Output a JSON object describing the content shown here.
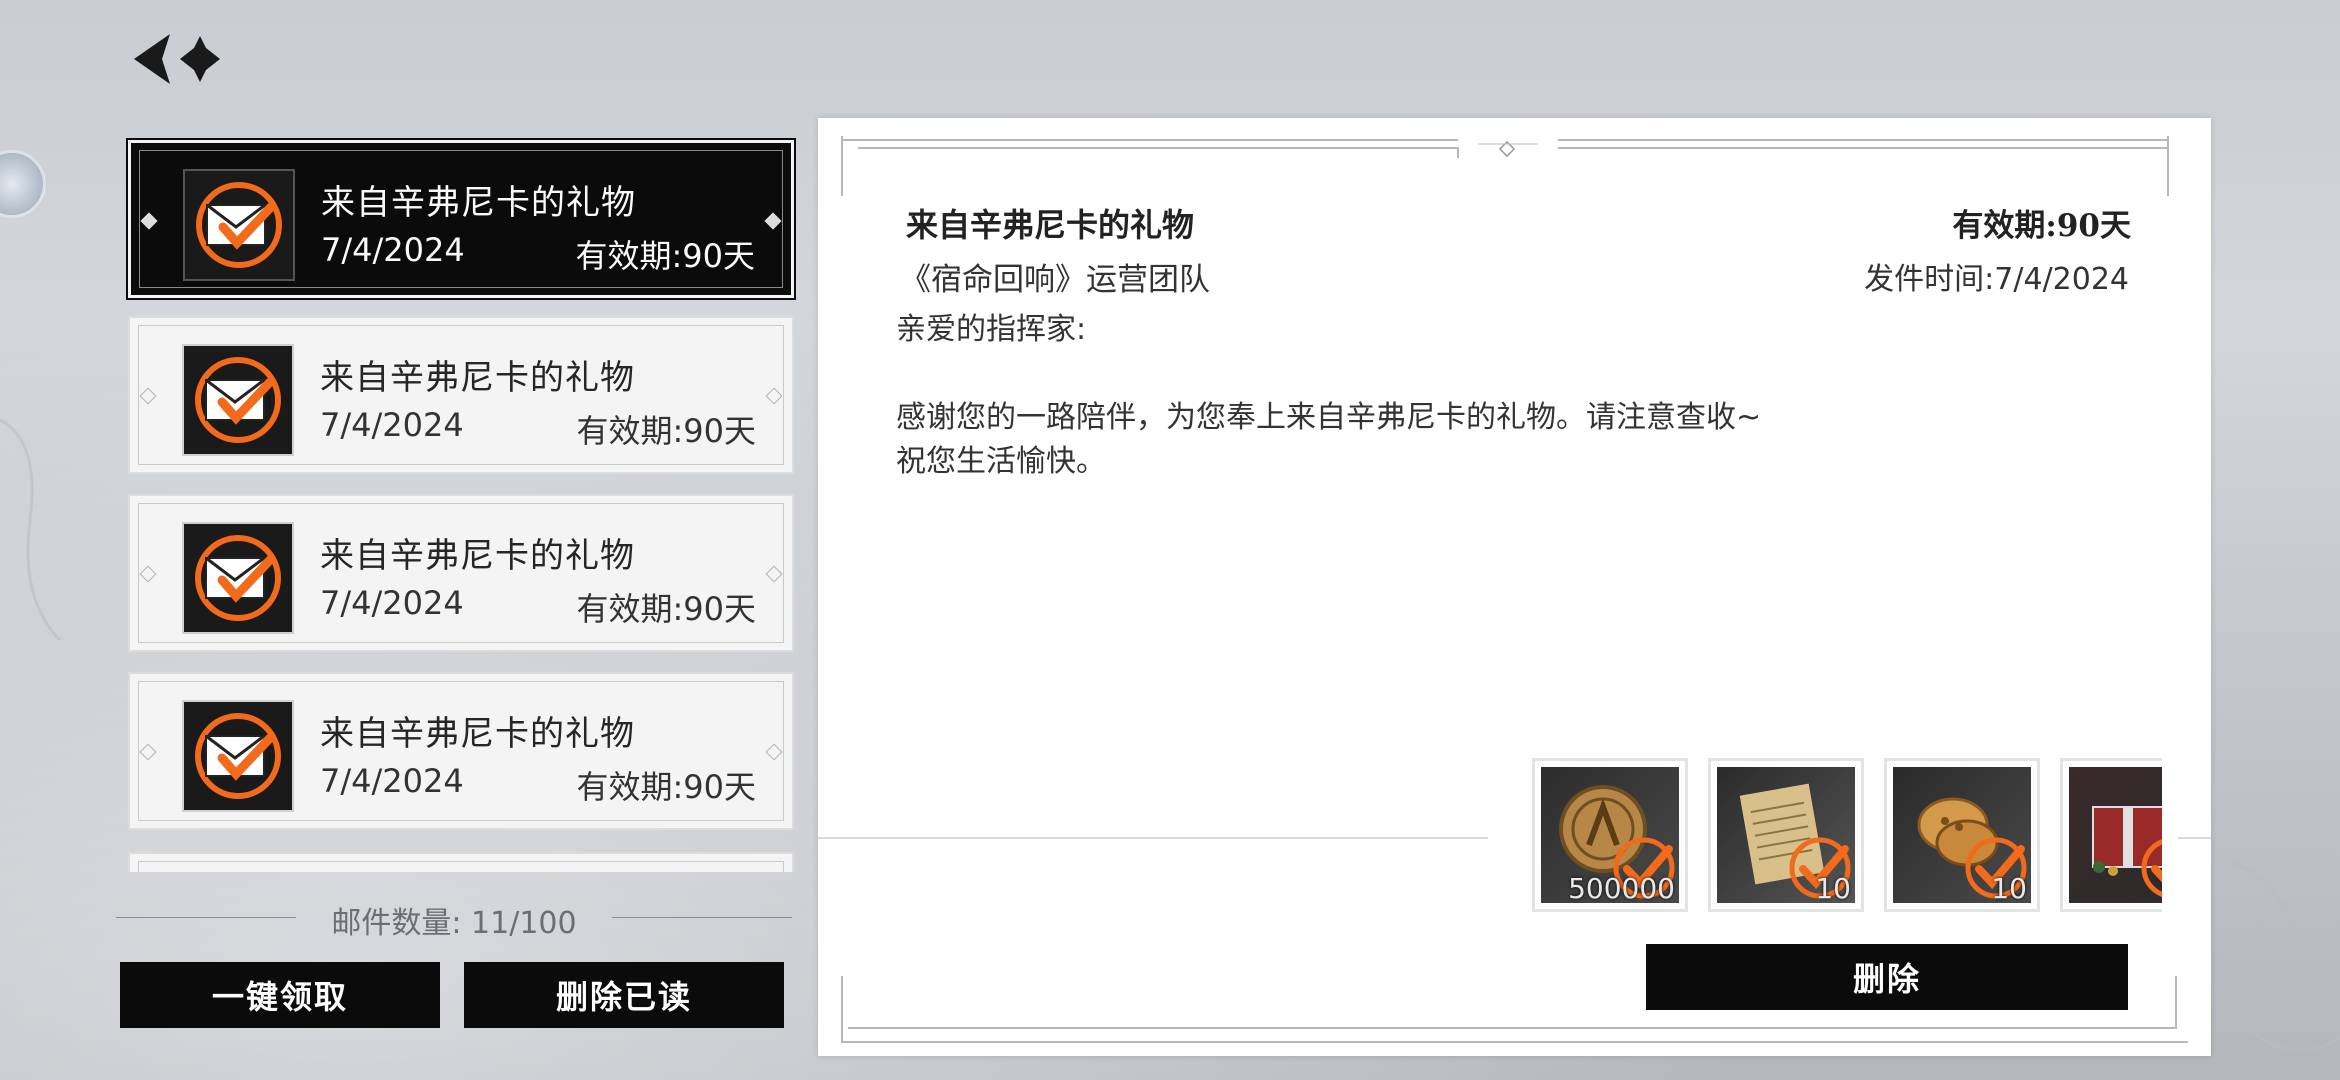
{
  "mail_list": [
    {
      "title": "来自辛弗尼卡的礼物",
      "date": "7/4/2024",
      "expiry": "有效期:90天",
      "selected": true
    },
    {
      "title": "来自辛弗尼卡的礼物",
      "date": "7/4/2024",
      "expiry": "有效期:90天",
      "selected": false
    },
    {
      "title": "来自辛弗尼卡的礼物",
      "date": "7/4/2024",
      "expiry": "有效期:90天",
      "selected": false
    },
    {
      "title": "来自辛弗尼卡的礼物",
      "date": "7/4/2024",
      "expiry": "有效期:90天",
      "selected": false
    }
  ],
  "footer": {
    "mail_count": "邮件数量: 11/100",
    "claim_all_label": "一键领取",
    "delete_read_label": "删除已读"
  },
  "detail": {
    "title": "来自辛弗尼卡的礼物",
    "expiry": "有效期:90天",
    "sender": "《宿命回响》运营团队",
    "send_time": "发件时间:7/4/2024",
    "greeting": "亲爱的指挥家:",
    "body": "感谢您的一路陪伴，为您奉上来自辛弗尼卡的礼物。请注意查收~\n祝您生活愉快。",
    "rewards": [
      {
        "icon": "gold-coin-icon",
        "quantity": "500000",
        "claimed": true
      },
      {
        "icon": "sheet-music-icon",
        "quantity": "10",
        "claimed": true
      },
      {
        "icon": "cookie-icon",
        "quantity": "10",
        "claimed": true
      },
      {
        "icon": "gift-box-icon",
        "quantity": "",
        "claimed": true
      }
    ],
    "delete_label": "删除"
  },
  "colors": {
    "accent_orange": "#f26a1b",
    "dark": "#0b0b0b",
    "panel_bg": "#ffffff"
  }
}
